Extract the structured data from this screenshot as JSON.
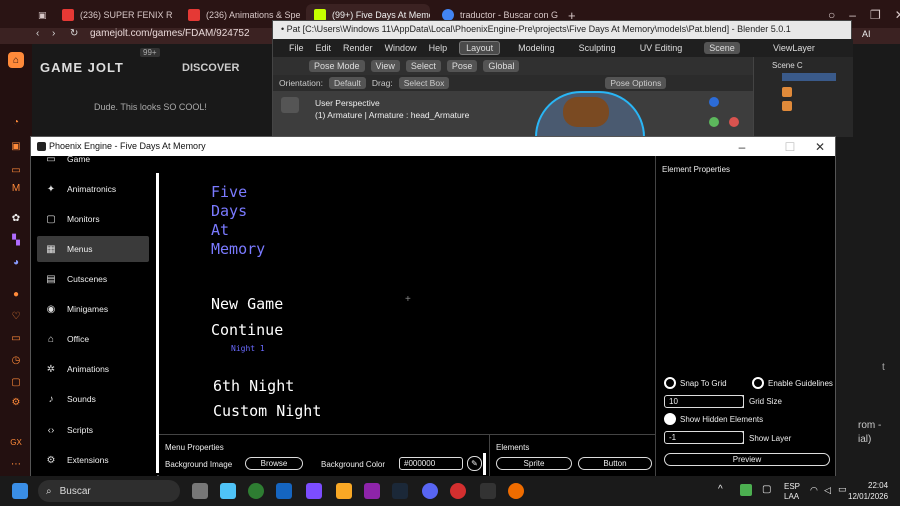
{
  "browser": {
    "tabs": [
      {
        "label": "(236) SUPER FENIX R",
        "color": "#e53935"
      },
      {
        "label": "(236) Animations & Spec",
        "color": "#e53935"
      },
      {
        "label": "(99+) Five Days At Memo",
        "color": "#c6ff00"
      },
      {
        "label": "traductor - Buscar con Go",
        "color": "#4285f4"
      }
    ],
    "new_tab": "+",
    "address": "gamejolt.com/games/FDAM/924752"
  },
  "gamejolt": {
    "logo": "GAME JOLT",
    "badge": "99+",
    "discover": "DISCOVER",
    "comment": "Dude. This looks SO COOL!"
  },
  "blender": {
    "title": "• Pat [C:\\Users\\Windows 11\\AppData\\Local\\PhoenixEngine-Pre\\projects\\Five Days At Memory\\models\\Pat.blend] - Blender 5.0.1",
    "menus": [
      "File",
      "Edit",
      "Render",
      "Window",
      "Help"
    ],
    "workspaces": [
      "Layout",
      "Modeling",
      "Sculpting",
      "UV Editing"
    ],
    "scene": "Scene",
    "view_layer": "ViewLayer",
    "mode": "Pose Mode",
    "tool_buttons": [
      "View",
      "Select",
      "Pose"
    ],
    "orientation_label": "Orientation:",
    "orientation": "Default",
    "drag_label": "Drag:",
    "drag": "Select Box",
    "transform": "Global",
    "pose_options": "Pose Options",
    "persp": "User Perspective",
    "armature": "(1) Armature | Armature : head_Armature",
    "outliner_title": "Scene C"
  },
  "phoenix": {
    "title": "Phoenix Engine - Five Days At Memory",
    "sidebar": [
      {
        "label": "Game",
        "icon": "▭"
      },
      {
        "label": "Animatronics",
        "icon": "✦"
      },
      {
        "label": "Monitors",
        "icon": "▢"
      },
      {
        "label": "Menus",
        "icon": "▦"
      },
      {
        "label": "Cutscenes",
        "icon": "▤"
      },
      {
        "label": "Minigames",
        "icon": "◉"
      },
      {
        "label": "Office",
        "icon": "⌂"
      },
      {
        "label": "Animations",
        "icon": "✲"
      },
      {
        "label": "Sounds",
        "icon": "♪"
      },
      {
        "label": "Scripts",
        "icon": "‹›"
      },
      {
        "label": "Extensions",
        "icon": "⚙"
      }
    ],
    "canvas": {
      "title_lines": [
        "Five",
        "Days",
        "At",
        "Memory"
      ],
      "new_game": "New Game",
      "continue": "Continue",
      "night": "Night 1",
      "sixth": "6th Night",
      "custom": "Custom Night"
    },
    "menu_props": {
      "title": "Menu Properties",
      "bg_image_label": "Background Image",
      "browse": "Browse",
      "bg_color_label": "Background Color",
      "bg_color": "#000000"
    },
    "elements": {
      "title": "Elements",
      "sprite": "Sprite",
      "button": "Button"
    },
    "element_props": {
      "title": "Element Properties",
      "snap": "Snap To Grid",
      "guides": "Enable Guidelines",
      "grid_value": "10",
      "grid_label": "Grid Size",
      "hidden": "Show Hidden Elements",
      "layer_value": "-1",
      "layer_label": "Show Layer",
      "preview": "Preview"
    }
  },
  "taskbar": {
    "search": "Buscar",
    "lang1": "ESP",
    "lang2": "LAA",
    "time": "22:04",
    "date": "12/01/2026"
  },
  "right_fragments": {
    "a": "t",
    "b": "rom -",
    "c": "ial)"
  }
}
